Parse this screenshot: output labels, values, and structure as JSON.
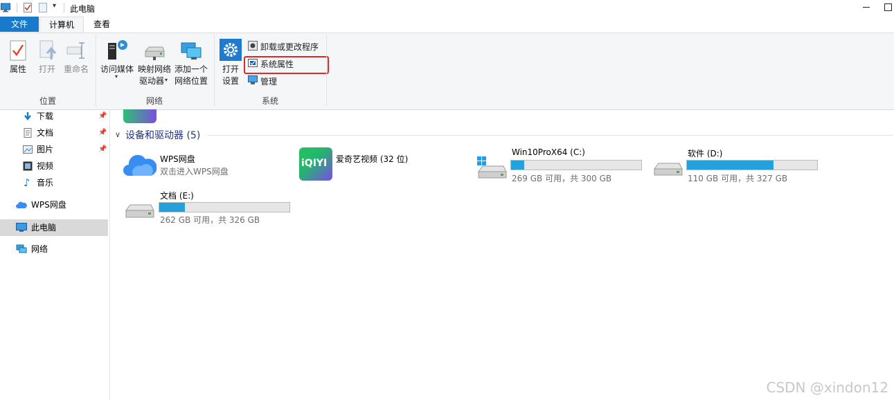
{
  "window": {
    "title": "此电脑"
  },
  "tabs": [
    {
      "label": "文件"
    },
    {
      "label": "计算机"
    },
    {
      "label": "查看"
    }
  ],
  "ribbon": {
    "location": {
      "label": "位置",
      "properties": "属性",
      "open": "打开",
      "rename": "重命名"
    },
    "network": {
      "label": "网络",
      "access_media": "访问媒体",
      "map_drive_line1": "映射网络",
      "map_drive_line2": "驱动器",
      "add_location_line1": "添加一个",
      "add_location_line2": "网络位置"
    },
    "system": {
      "label": "系统",
      "open_settings_line1": "打开",
      "open_settings_line2": "设置",
      "uninstall": "卸载或更改程序",
      "system_properties": "系统属性",
      "manage": "管理"
    }
  },
  "nav": {
    "items": [
      {
        "label": "下载",
        "icon": "download-icon"
      },
      {
        "label": "文档",
        "icon": "document-icon"
      },
      {
        "label": "图片",
        "icon": "picture-icon"
      },
      {
        "label": "视频",
        "icon": "video-icon"
      },
      {
        "label": "音乐",
        "icon": "music-icon"
      },
      {
        "label": "WPS网盘",
        "icon": "cloud-icon"
      },
      {
        "label": "此电脑",
        "icon": "computer-icon"
      },
      {
        "label": "网络",
        "icon": "network-icon"
      }
    ]
  },
  "content": {
    "section_title": "设备和驱动器 (5)",
    "items": [
      {
        "name": "WPS网盘",
        "sub": "双击进入WPS网盘"
      },
      {
        "name": "爱奇艺视频 (32 位)",
        "logo_text": "iQIYI"
      },
      {
        "name": "Win10ProX64 (C:)",
        "space": "269 GB 可用，共 300 GB",
        "used_fraction": 0.103
      },
      {
        "name": "软件 (D:)",
        "space": "110 GB 可用，共 327 GB",
        "used_fraction": 0.664
      },
      {
        "name": "文档 (E:)",
        "space": "262 GB 可用，共 326 GB",
        "used_fraction": 0.196
      }
    ]
  },
  "watermark": "CSDN @xindon12",
  "colors": {
    "accent": "#1979ca",
    "bar_fill": "#26a0da",
    "highlight": "#e02828"
  }
}
